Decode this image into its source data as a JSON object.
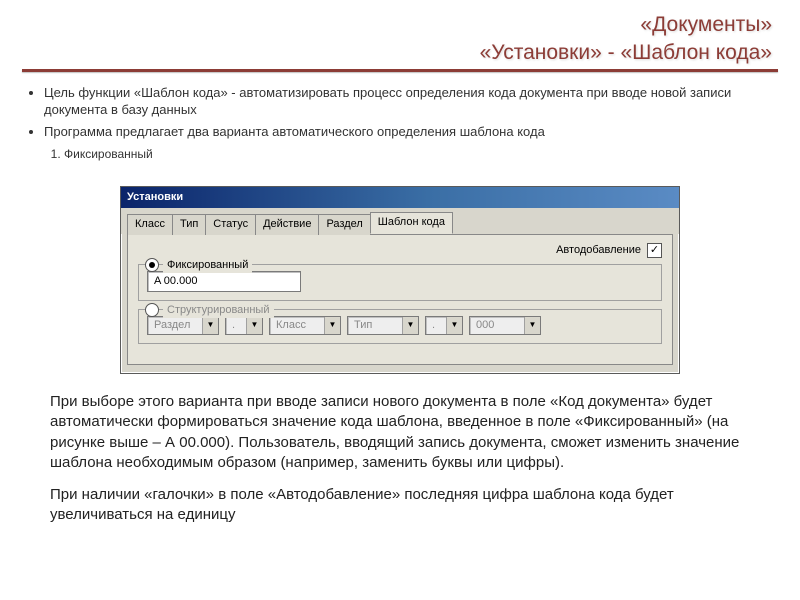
{
  "header": {
    "line1": "«Документы»",
    "line2": "«Установки» - «Шаблон кода»"
  },
  "bullets": [
    "Цель функции «Шаблон кода» - автоматизировать процесс определения кода документа при вводе новой записи документа в базу данных",
    "Программа предлагает два варианта автоматического определения шаблона кода"
  ],
  "numbered": [
    "Фиксированный"
  ],
  "window": {
    "title": "Установки",
    "tabs": [
      "Класс",
      "Тип",
      "Статус",
      "Действие",
      "Раздел",
      "Шаблон кода"
    ],
    "active_tab": "Шаблон кода",
    "auto_label": "Автодобавление",
    "auto_checked": "✓",
    "group_fixed": {
      "legend": "Фиксированный",
      "value": "A 00.000",
      "selected": true
    },
    "group_struct": {
      "legend": "Структурированный",
      "selected": false,
      "sep": ".",
      "selects": [
        "Раздел",
        ".",
        "Класс",
        "Тип",
        ".",
        "000"
      ]
    }
  },
  "para1": "При выборе этого варианта при вводе записи нового документа в поле «Код документа» будет автоматически формироваться значение кода шаблона, введенное в поле «Фиксированный» (на рисунке выше – А 00.000). Пользователь, вводящий запись документа, сможет изменить значение шаблона необходимым образом (например, заменить буквы или цифры).",
  "para2": "При наличии «галочки» в поле «Автодобавление» последняя цифра шаблона кода будет увеличиваться на единицу"
}
